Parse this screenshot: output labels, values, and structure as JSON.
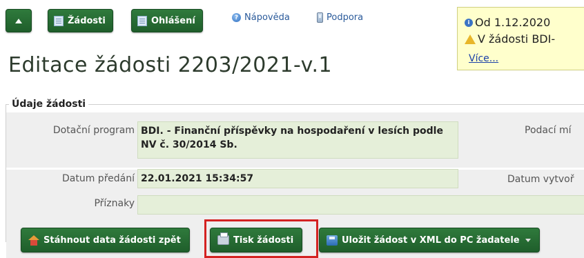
{
  "toolbar": {
    "requests_label": "Žádosti",
    "reports_label": "Ohlášení",
    "help_label": "Nápověda",
    "support_label": "Podpora"
  },
  "notice": {
    "line1": "Od 1.12.2020",
    "line2": "V žádosti BDI-",
    "more_label": "Více..."
  },
  "page": {
    "title": "Editace žádosti 2203/2021-v.1"
  },
  "section": {
    "legend": "Údaje žádosti",
    "fields": {
      "program_label": "Dotační program",
      "program_value": "BDI. - Finanční příspěvky na hospodaření v lesích podle NV č. 30/2014 Sb.",
      "podaci_label": "Podací mí",
      "handover_label": "Datum předání",
      "handover_value": "22.01.2021 15:34:57",
      "created_label": "Datum vytvoř",
      "flags_label": "Příznaky",
      "flags_value": ""
    }
  },
  "actions": {
    "download_label": "Stáhnout data žádosti zpět",
    "print_label": "Tisk žádosti",
    "save_xml_label": "Uložit žádost v XML do PC žadatele"
  },
  "colors": {
    "button_green": "#1f5e2b",
    "value_bg": "#e5efd9",
    "notice_bg": "#ffffcc",
    "highlight_red": "#d42222"
  }
}
